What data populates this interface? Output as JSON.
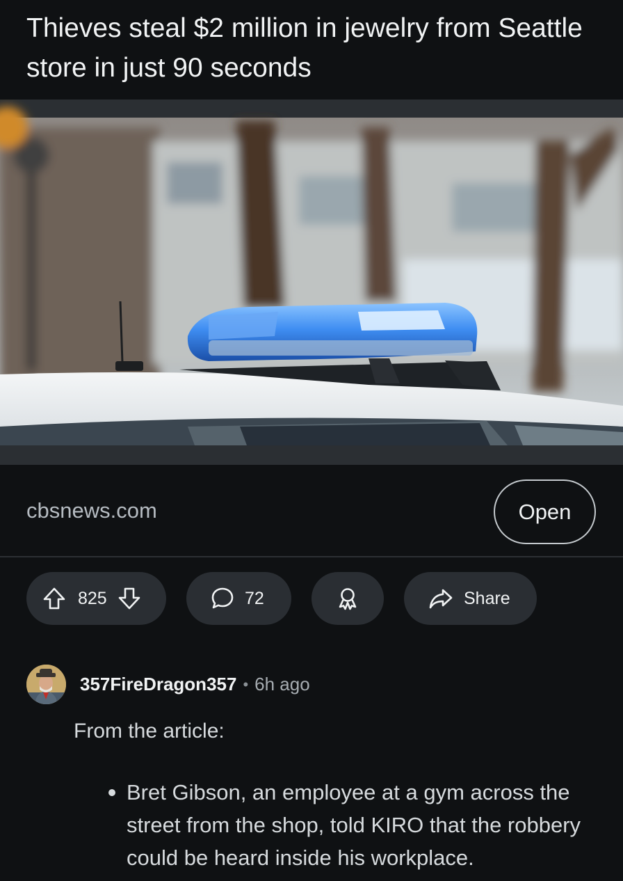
{
  "post": {
    "title": "Thieves steal $2 million in jewelry from Seattle store in just 90 seconds",
    "image_subject": "police-car-roof-light-bar"
  },
  "link": {
    "domain": "cbsnews.com",
    "open_label": "Open"
  },
  "actions": {
    "upvote_icon": "arrow-up-icon",
    "vote_count": "825",
    "downvote_icon": "arrow-down-icon",
    "comment_icon": "speech-bubble-icon",
    "comment_count": "72",
    "award_icon": "award-icon",
    "share_icon": "share-arrow-icon",
    "share_label": "Share"
  },
  "comment": {
    "username": "357FireDragon357",
    "separator": "•",
    "timestamp": "6h ago",
    "lead": "From the article:",
    "bullets": [
      "Bret Gibson, an employee at a gym across the street from the shop, told KIRO that the robbery could be heard inside his workplace."
    ]
  },
  "colors": {
    "background": "#0f1113",
    "pill": "#2a2e33",
    "light_bar_blue": "#3f8ef2"
  }
}
